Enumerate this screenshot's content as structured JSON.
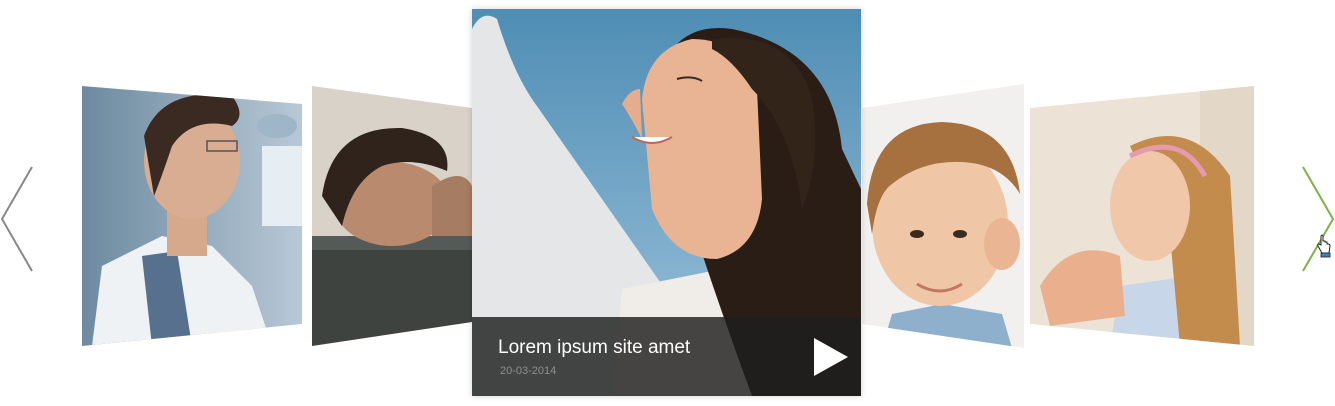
{
  "carousel": {
    "prev_icon": "chevron-left-icon",
    "next_icon": "chevron-right-icon",
    "colors": {
      "prev_arrow": "#888888",
      "next_arrow": "#7cb342",
      "caption_bg": "#1e1e1e",
      "caption_title": "#ffffff",
      "caption_date": "#8f8f8f"
    },
    "slides": [
      {
        "subject": "doctor-photo"
      },
      {
        "subject": "tired-man-photo"
      },
      {
        "subject": "smiling-woman-photo"
      },
      {
        "subject": "child-ear-photo"
      },
      {
        "subject": "girl-throat-exam-photo"
      }
    ],
    "active_slide": {
      "title": "Lorem ipsum site amet",
      "date": "20-03-2014",
      "play_icon": "play-icon"
    }
  }
}
